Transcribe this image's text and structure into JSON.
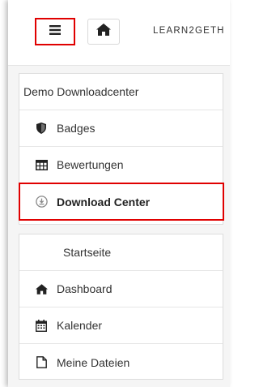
{
  "header": {
    "brand": "LEARN2GETH"
  },
  "panel1": {
    "title": "Demo Downloadcenter",
    "items": [
      {
        "label": "Badges",
        "icon": "shield-icon"
      },
      {
        "label": "Bewertungen",
        "icon": "table-icon"
      },
      {
        "label": "Download Center",
        "icon": "download-icon"
      }
    ]
  },
  "panel2": {
    "items": [
      {
        "label": "Startseite",
        "icon": ""
      },
      {
        "label": "Dashboard",
        "icon": "home-icon"
      },
      {
        "label": "Kalender",
        "icon": "calendar-icon"
      },
      {
        "label": "Meine Dateien",
        "icon": "file-icon"
      }
    ]
  },
  "colors": {
    "highlight": "#e00000"
  }
}
